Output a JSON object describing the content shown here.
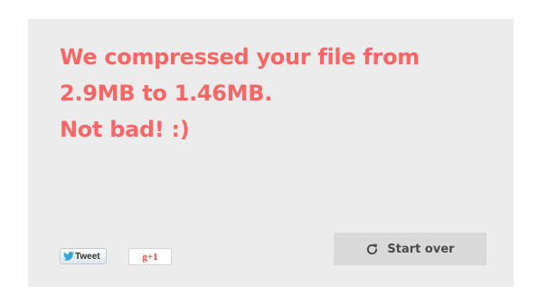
{
  "result": {
    "line1": "We compressed your file from",
    "line2": "2.9MB to 1.46MB.",
    "line3": "Not bad! :)"
  },
  "social": {
    "tweet_label": "Tweet",
    "gplus_label": "g+1",
    "icons": {
      "tweet": "twitter-bird-icon"
    }
  },
  "actions": {
    "start_over_label": "Start over",
    "start_over_icon": "refresh-icon"
  },
  "colors": {
    "accent": "#f86766",
    "panel": "#ececec",
    "button": "#d9d9d9",
    "gplus": "#dd4b39"
  }
}
